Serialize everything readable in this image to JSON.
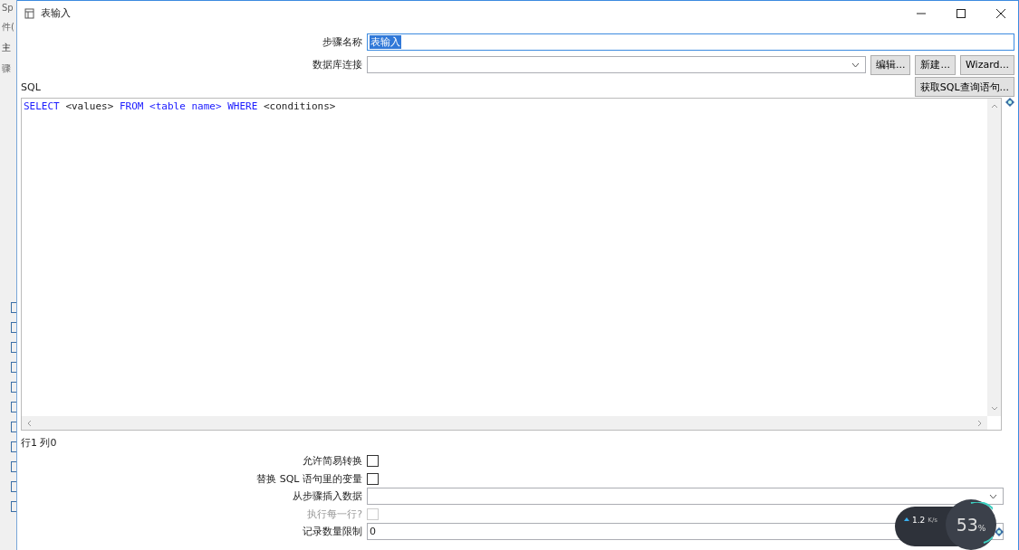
{
  "background_window": {
    "title": "Sp",
    "menu": "件(",
    "tab": "主",
    "label": "骤",
    "checkboxes": [
      {
        "checked": false
      },
      {
        "checked": false
      },
      {
        "checked": false
      },
      {
        "checked": false
      },
      {
        "checked": false
      },
      {
        "checked": false
      },
      {
        "checked": false
      },
      {
        "checked": false
      },
      {
        "checked": false
      },
      {
        "checked": false
      },
      {
        "checked": false
      }
    ]
  },
  "window": {
    "title": "表输入"
  },
  "step_name": {
    "label": "步骤名称",
    "value": "表输入",
    "selected_text": true
  },
  "connection": {
    "label": "数据库连接",
    "buttons": [
      "编辑...",
      "新建...",
      "Wizard..."
    ]
  },
  "sql_label": "SQL",
  "get_sql_button": "获取SQL查询语句...",
  "sql_tokens": [
    {
      "text": "SELECT",
      "kind": "keyword"
    },
    {
      "text": "<values>",
      "kind": "plain"
    },
    {
      "text": "FROM",
      "kind": "keyword"
    },
    {
      "text": "<table name>",
      "kind": "keyword"
    },
    {
      "text": "WHERE",
      "kind": "keyword"
    },
    {
      "text": "<conditions>",
      "kind": "plain"
    }
  ],
  "cursor_position": "行1 列0",
  "options": [
    {
      "kind": "checkbox",
      "label": "允许简易转换",
      "checked": false,
      "disabled": false
    },
    {
      "kind": "checkbox",
      "label": "替换 SQL 语句里的变量",
      "checked": false,
      "disabled": false
    },
    {
      "kind": "combo",
      "label": "从步骤插入数据"
    },
    {
      "kind": "checkbox",
      "label": "执行每一行?",
      "checked": false,
      "disabled": true
    },
    {
      "kind": "text",
      "label": "记录数量限制",
      "value": "0"
    }
  ],
  "network_widget": {
    "upload_value": "1.2",
    "upload_unit": "K/s",
    "percent": "53",
    "percent_unit": "%"
  }
}
